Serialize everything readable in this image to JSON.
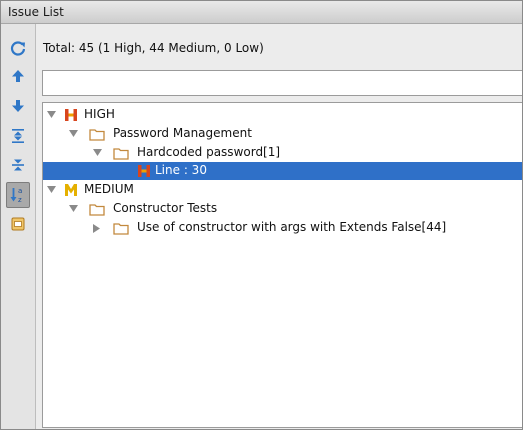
{
  "window": {
    "title": "Issue List"
  },
  "summary": {
    "total": "Total: 45 (1 High, 44 Medium, 0 Low)"
  },
  "search": {
    "value": "",
    "placeholder": ""
  },
  "tree": {
    "high": {
      "label": "HIGH",
      "category": {
        "label": "Password Management",
        "issue": {
          "label": "Hardcoded password[1]",
          "line": "Line : 30"
        }
      }
    },
    "medium": {
      "label": "MEDIUM",
      "category": {
        "label": "Constructor Tests",
        "issue": {
          "label": "Use of constructor with args with Extends False[44]"
        }
      }
    }
  },
  "colors": {
    "selection": "#2f70c8",
    "toolbar_icon": "#2f77c7",
    "high_badge": "#d8451d",
    "medium_badge": "#e5b000",
    "folder": "#c2893d"
  },
  "icons": {
    "toolbar": [
      "refresh-icon",
      "arrow-up-icon",
      "arrow-down-icon",
      "expand-all-icon",
      "collapse-all-icon",
      "sort-az-icon",
      "group-icon"
    ],
    "tree": [
      "high-severity-icon",
      "medium-severity-icon",
      "folder-icon",
      "expand-arrow-icon",
      "collapse-arrow-icon"
    ]
  }
}
